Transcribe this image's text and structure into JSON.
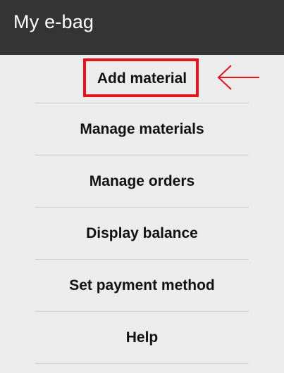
{
  "header": {
    "title": "My e-bag"
  },
  "menu": {
    "items": [
      {
        "label": "Add material"
      },
      {
        "label": "Manage materials"
      },
      {
        "label": "Manage orders"
      },
      {
        "label": "Display balance"
      },
      {
        "label": "Set payment method"
      },
      {
        "label": "Help"
      }
    ]
  },
  "colors": {
    "header_bg": "#343434",
    "page_bg": "#ececec",
    "highlight": "#e3141b"
  },
  "annotation": {
    "icon": "arrow-left-icon"
  }
}
